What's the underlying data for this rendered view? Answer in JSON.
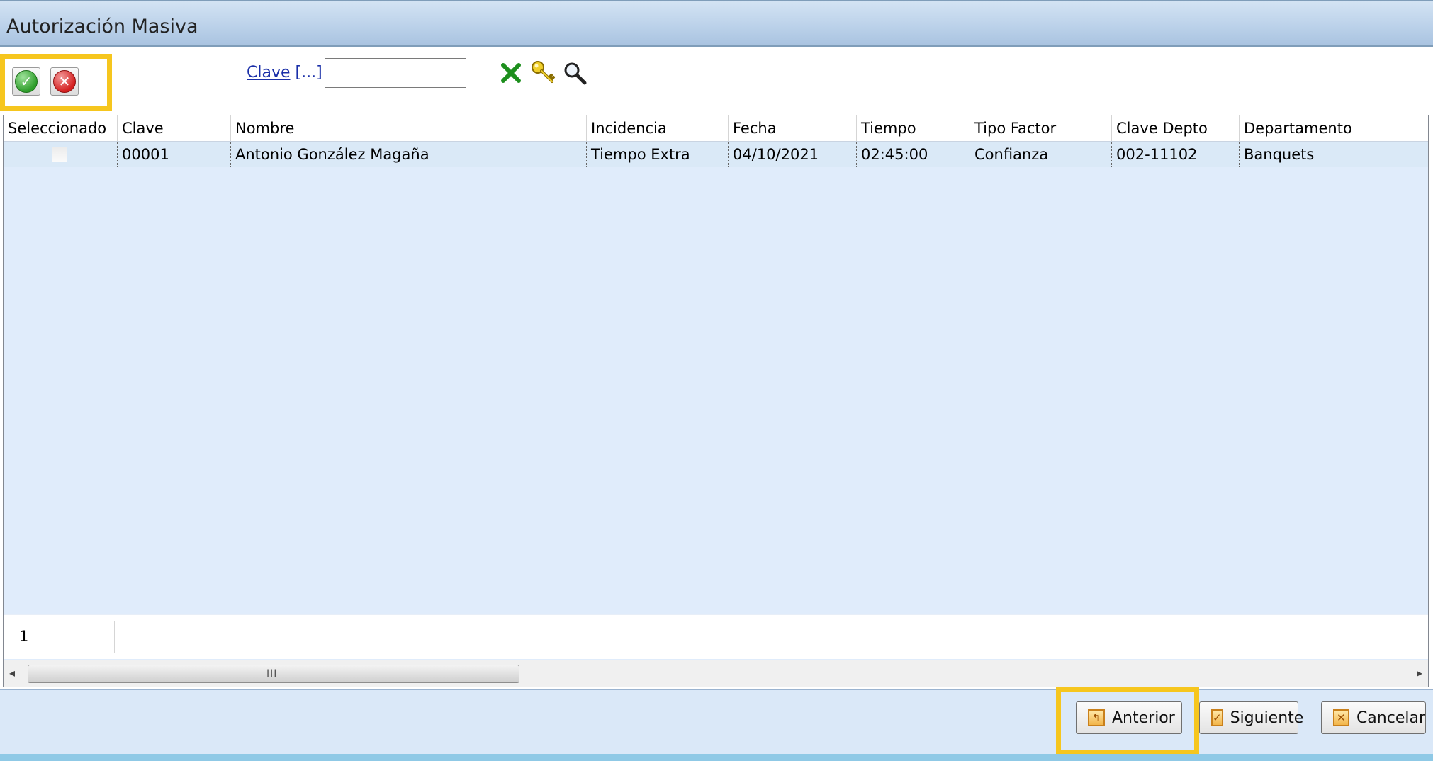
{
  "window": {
    "title": "Autorización Masiva"
  },
  "toolbar": {
    "accept_symbol": "✓",
    "reject_symbol": "✕",
    "clave_label": "Clave",
    "clave_ellipsis": "[...]",
    "clave_value": "",
    "icons": [
      "clear-x-icon",
      "key-icon",
      "magnifier-icon"
    ]
  },
  "grid": {
    "columns": [
      "Seleccionado",
      "Clave",
      "Nombre",
      "Incidencia",
      "Fecha",
      "Tiempo",
      "Tipo Factor",
      "Clave Depto",
      "Departamento"
    ],
    "rows": [
      {
        "seleccionado": false,
        "clave": "00001",
        "nombre": "Antonio González Magaña",
        "incidencia": "Tiempo Extra",
        "fecha": "04/10/2021",
        "tiempo": "02:45:00",
        "tipo_factor": "Confianza",
        "clave_depto": "002-11102",
        "departamento": "Banquets"
      }
    ],
    "footer_count": "1",
    "scroll_grip": "III"
  },
  "buttons": {
    "anterior": "Anterior",
    "siguiente": "Siguiente",
    "cancelar": "Cancelar"
  },
  "colors": {
    "highlight": "#f6c61e",
    "titlebar": "#bcd2ea",
    "grid_bg": "#e0ecfb",
    "row_bg": "#dae9f7"
  }
}
